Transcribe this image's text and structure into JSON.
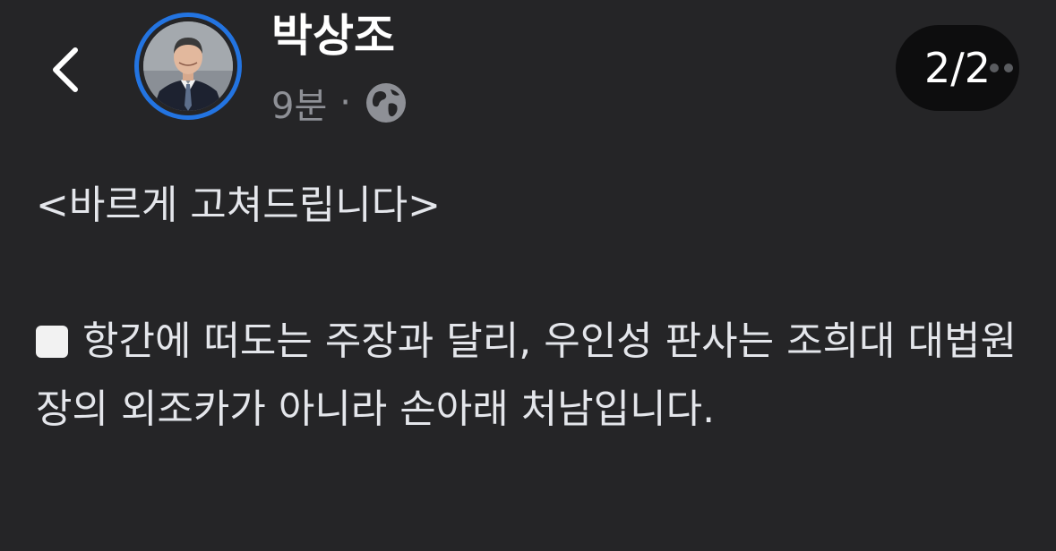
{
  "header": {
    "back_label": "back",
    "author_name": "박상조",
    "time_ago": "9분",
    "separator": "·",
    "privacy_icon": "globe-icon",
    "page_indicator": "2/2"
  },
  "post": {
    "heading": "<바르게 고쳐드립니다>",
    "bullet_icon": "white-square",
    "paragraph": "항간에 떠도는 주장과 달리, 우인성 판사는 조희대 대법원장의 외조카가 아니라 손아래 처남입니다."
  },
  "colors": {
    "background": "#252527",
    "avatar_ring": "#2374e1",
    "text": "#e4e6eb",
    "muted": "#8e9096",
    "pill": "#0d0d0e"
  }
}
